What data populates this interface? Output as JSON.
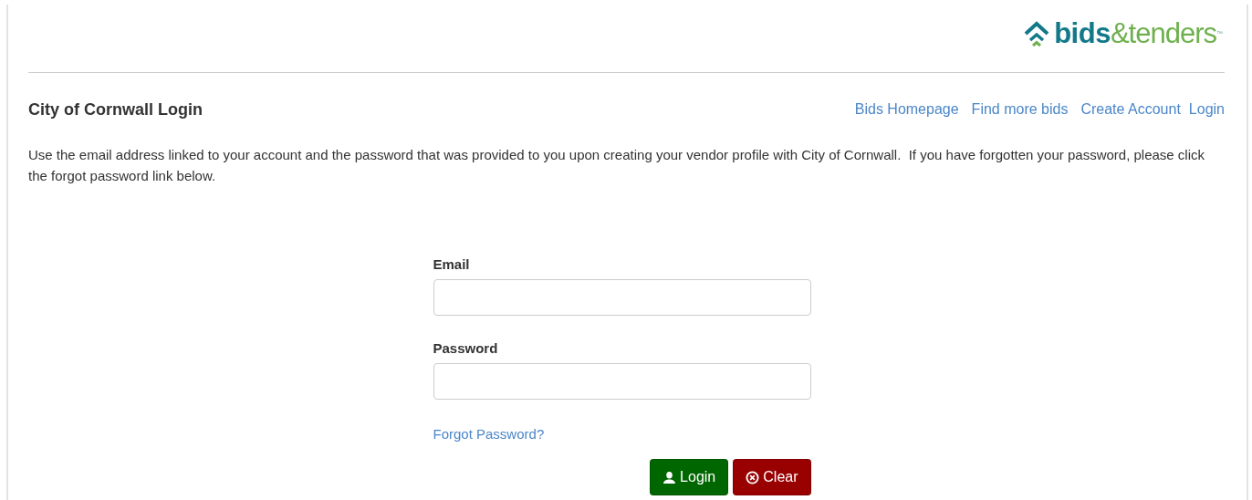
{
  "logo": {
    "bold": "bids",
    "light": "&tenders",
    "mark": "™"
  },
  "header": {
    "title": "City of Cornwall Login",
    "links": [
      "Bids Homepage",
      "Find more bids",
      "Create Account",
      "Login"
    ]
  },
  "intro": "Use the email address linked to your account and the password that was provided to you upon creating your vendor profile with City of Cornwall.  If you have forgotten your password, please click the forgot password link below.",
  "form": {
    "fields": [
      {
        "label": "Email"
      },
      {
        "label": "Password"
      }
    ],
    "forgot_link": "Forgot Password?",
    "buttons": [
      {
        "label": "Login",
        "kind": "primary"
      },
      {
        "label": "Clear",
        "kind": "danger"
      }
    ]
  }
}
